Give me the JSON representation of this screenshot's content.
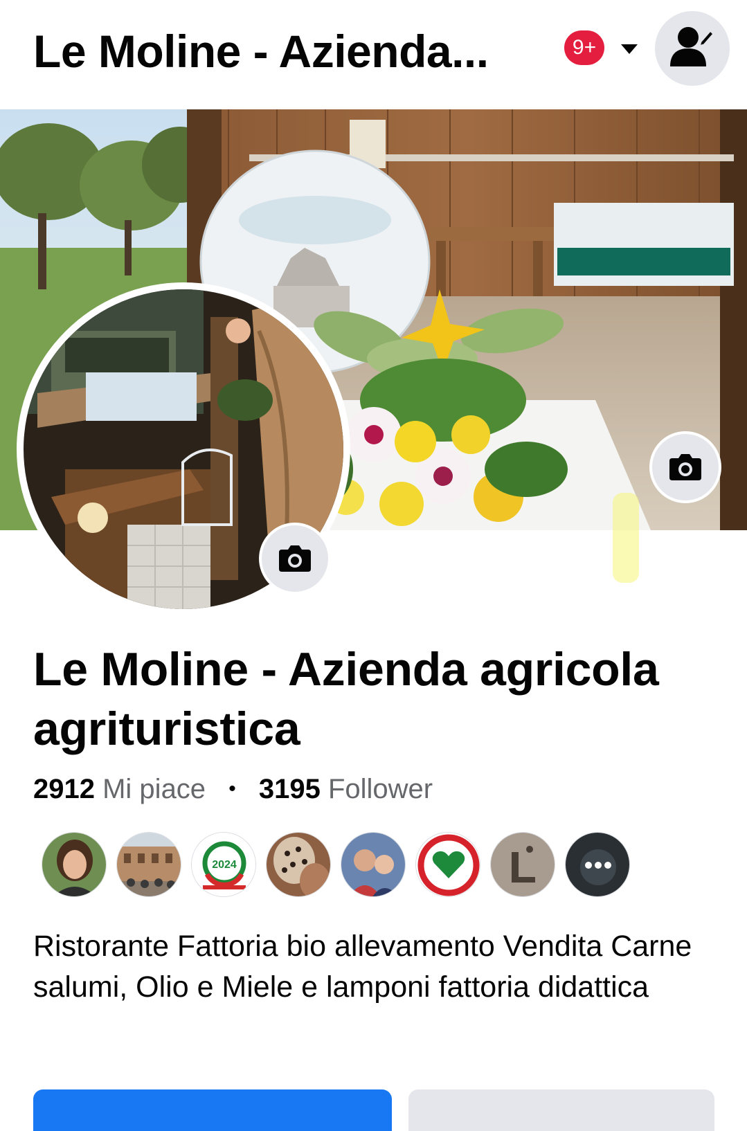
{
  "header": {
    "title": "Le Moline - Azienda...",
    "notifications_badge": "9+",
    "menu_icon": "caret-down-icon",
    "profile_switch_icon": "switch-profile-icon"
  },
  "page": {
    "name": "Le Moline - Azienda agricola agrituristica",
    "likes_count": "2912",
    "likes_label": "Mi piace",
    "separator": "•",
    "followers_count": "3195",
    "followers_label": "Follower",
    "description": "Ristorante Fattoria bio allevamento Vendita Carne salumi,  Olio e Miele e lamponi fattoria didattica"
  },
  "friends": [
    {
      "name": "friend-1"
    },
    {
      "name": "friend-2"
    },
    {
      "name": "friend-3"
    },
    {
      "name": "friend-4"
    },
    {
      "name": "friend-5"
    },
    {
      "name": "friend-6"
    },
    {
      "name": "friend-7"
    },
    {
      "name": "friend-more"
    }
  ],
  "actions": {
    "primary_label": "",
    "secondary_label": ""
  },
  "colors": {
    "accent": "#1877f2",
    "badge": "#e41e3f",
    "muted_text": "#65676b",
    "button_grey": "#e4e6eb"
  }
}
